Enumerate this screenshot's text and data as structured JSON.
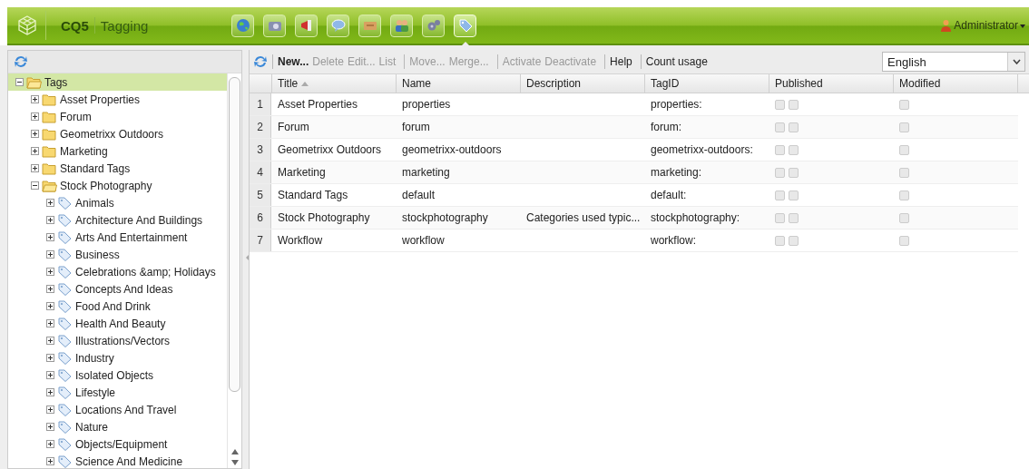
{
  "header": {
    "product": "CQ5",
    "section": "Tagging",
    "apps": [
      {
        "kind": "globe",
        "selected": false
      },
      {
        "kind": "camera",
        "selected": false
      },
      {
        "kind": "megaphone",
        "selected": false
      },
      {
        "kind": "bubble",
        "selected": false
      },
      {
        "kind": "inbox",
        "selected": false
      },
      {
        "kind": "users",
        "selected": false
      },
      {
        "kind": "gears",
        "selected": false
      },
      {
        "kind": "tag",
        "selected": true
      }
    ],
    "user": "Administrator"
  },
  "tree": {
    "label": "Tags",
    "expanded": true,
    "selected": true,
    "kind": "folder",
    "children": [
      {
        "label": "Asset Properties",
        "kind": "folder",
        "expanded": false
      },
      {
        "label": "Forum",
        "kind": "folder",
        "expanded": false
      },
      {
        "label": "Geometrixx Outdoors",
        "kind": "folder",
        "expanded": false
      },
      {
        "label": "Marketing",
        "kind": "folder",
        "expanded": false
      },
      {
        "label": "Standard Tags",
        "kind": "folder",
        "expanded": false
      },
      {
        "label": "Stock Photography",
        "kind": "folder",
        "expanded": true,
        "children": [
          {
            "label": "Animals",
            "kind": "tag",
            "expanded": false
          },
          {
            "label": "Architecture And Buildings",
            "kind": "tag",
            "expanded": false
          },
          {
            "label": "Arts And Entertainment",
            "kind": "tag",
            "expanded": false
          },
          {
            "label": "Business",
            "kind": "tag",
            "expanded": false
          },
          {
            "label": "Celebrations &amp; Holidays",
            "kind": "tag",
            "expanded": false
          },
          {
            "label": "Concepts And Ideas",
            "kind": "tag",
            "expanded": false
          },
          {
            "label": "Food And Drink",
            "kind": "tag",
            "expanded": false
          },
          {
            "label": "Health And Beauty",
            "kind": "tag",
            "expanded": false
          },
          {
            "label": "Illustrations/Vectors",
            "kind": "tag",
            "expanded": false
          },
          {
            "label": "Industry",
            "kind": "tag",
            "expanded": false
          },
          {
            "label": "Isolated Objects",
            "kind": "tag",
            "expanded": false
          },
          {
            "label": "Lifestyle",
            "kind": "tag",
            "expanded": false
          },
          {
            "label": "Locations And Travel",
            "kind": "tag",
            "expanded": false
          },
          {
            "label": "Nature",
            "kind": "tag",
            "expanded": false
          },
          {
            "label": "Objects/Equipment",
            "kind": "tag",
            "expanded": false
          },
          {
            "label": "Science And Medicine",
            "kind": "tag",
            "expanded": false
          }
        ]
      }
    ]
  },
  "toolbar": {
    "groups": [
      [
        {
          "label": "New...",
          "disabled": false
        },
        {
          "label": "Delete",
          "disabled": true
        },
        {
          "label": "Edit...",
          "disabled": true
        },
        {
          "label": "List",
          "disabled": true
        }
      ],
      [
        {
          "label": "Move...",
          "disabled": true
        },
        {
          "label": "Merge...",
          "disabled": true
        }
      ],
      [
        {
          "label": "Activate",
          "disabled": true
        },
        {
          "label": "Deactivate",
          "disabled": true
        }
      ],
      [
        {
          "label": "Help",
          "disabled": false
        }
      ],
      [
        {
          "label": "Count usage",
          "disabled": false
        }
      ]
    ],
    "language": "English"
  },
  "table": {
    "columns": [
      "Title",
      "Name",
      "Description",
      "TagID",
      "Published",
      "Modified"
    ],
    "rows": [
      {
        "number": "1",
        "title": "Asset Properties",
        "name": "properties",
        "tagid": "properties:"
      },
      {
        "number": "2",
        "title": "Forum",
        "name": "forum",
        "tagid": "forum:"
      },
      {
        "number": "3",
        "title": "Geometrixx Outdoors",
        "name": "geometrixx-outdoors",
        "tagid": "geometrixx-outdoors:"
      },
      {
        "number": "4",
        "title": "Marketing",
        "name": "marketing",
        "tagid": "marketing:"
      },
      {
        "number": "5",
        "title": "Standard Tags",
        "name": "default",
        "tagid": "default:"
      },
      {
        "number": "6",
        "title": "Stock Photography",
        "name": "stockphotography",
        "description": "Categories used typic...",
        "tagid": "stockphotography:"
      },
      {
        "number": "7",
        "title": "Workflow",
        "name": "workflow",
        "tagid": "workflow:"
      }
    ]
  }
}
